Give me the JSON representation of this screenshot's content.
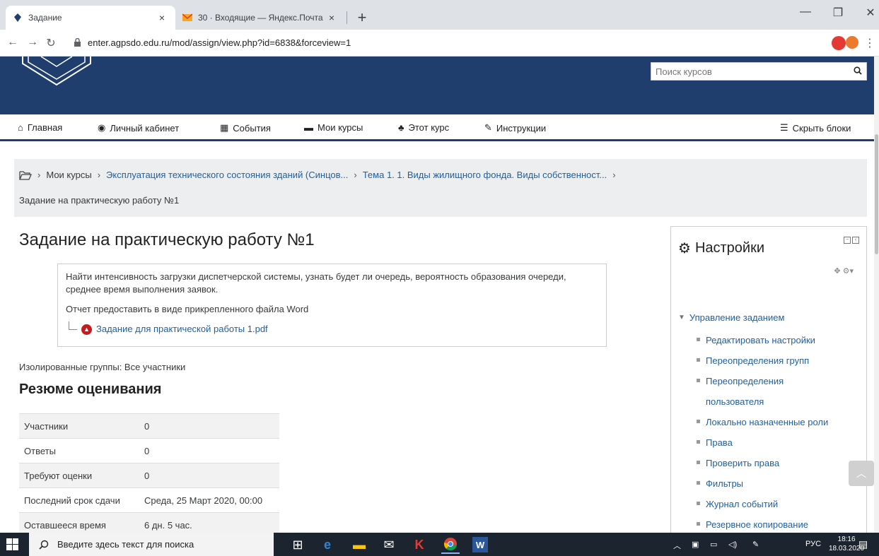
{
  "browser": {
    "tabs": [
      {
        "title": "Задание",
        "active": true
      },
      {
        "title": "30 · Входящие — Яндекс.Почта",
        "active": false
      }
    ],
    "close_glyph": "×",
    "newtab_glyph": "+",
    "url": "enter.agpsdo.edu.ru/mod/assign/view.php?id=6838&forceview=1"
  },
  "header": {
    "search_placeholder": "Поиск курсов"
  },
  "nav": {
    "items": [
      {
        "label": "Главная",
        "icon": "home-icon"
      },
      {
        "label": "Личный кабинет",
        "icon": "dashboard-icon"
      },
      {
        "label": "События",
        "icon": "calendar-icon"
      },
      {
        "label": "Мои курсы",
        "icon": "briefcase-icon"
      },
      {
        "label": "Этот курс",
        "icon": "sitemap-icon"
      },
      {
        "label": "Инструкции",
        "icon": "wrench-icon"
      }
    ],
    "hide_blocks": "Скрыть блоки"
  },
  "breadcrumb": {
    "sep": "›",
    "items": [
      "Мои курсы",
      "Эксплуатация технического состояния зданий (Синцов...",
      "Тема 1. 1. Виды жилищного фонда. Виды собственност..."
    ],
    "current": "Задание на практическую работу №1"
  },
  "main": {
    "title": "Задание на практическую работу №1",
    "intro_p1": "Найти интенсивность загрузки диспетчерской системы, узнать будет ли очередь, вероятность образования очереди, среднее время выполнения заявок.",
    "intro_p2": "Отчет предоставить в виде прикрепленного файла Word",
    "attachment": "Задание для практической работы 1.pdf",
    "groups": "Изолированные группы: Все участники",
    "summary_title": "Резюме оценивания",
    "summary": [
      {
        "key": "Участники",
        "value": "0"
      },
      {
        "key": "Ответы",
        "value": "0"
      },
      {
        "key": "Требуют оценки",
        "value": "0"
      },
      {
        "key": "Последний срок сдачи",
        "value": "Среда, 25 Март 2020, 00:00"
      },
      {
        "key": "Оставшееся время",
        "value": "6 дн. 5 час."
      }
    ]
  },
  "settings_block": {
    "title": "Настройки",
    "root": "Управление заданием",
    "items": [
      "Редактировать настройки",
      "Переопределения групп",
      "Переопределения пользователя",
      "Локально назначенные роли",
      "Права",
      "Проверить права",
      "Фильтры",
      "Журнал событий",
      "Резервное копирование"
    ]
  },
  "taskbar": {
    "search_placeholder": "Введите здесь текст для поиска",
    "lang": "РУС",
    "time": "18:16",
    "date": "18.03.2020"
  }
}
